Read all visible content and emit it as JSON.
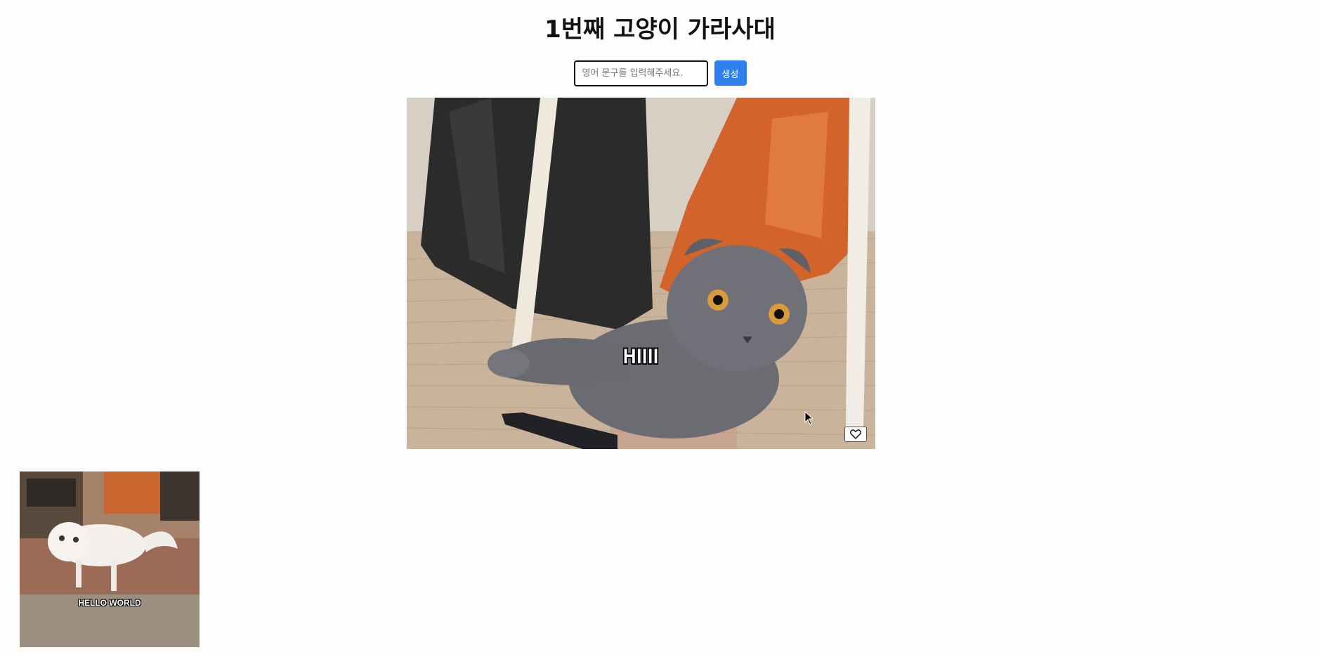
{
  "page": {
    "title": "1번째 고양이 가라사대"
  },
  "form": {
    "input_placeholder": "영어 문구를 입력해주세요.",
    "input_value": "",
    "submit_label": "생성"
  },
  "main_image": {
    "caption": "HIIII",
    "like_icon": "heart-outline-icon"
  },
  "gallery": {
    "items": [
      {
        "caption": "HELLO WORLD"
      }
    ]
  },
  "colors": {
    "accent": "#2f7ff0",
    "background": "#fefdfd"
  }
}
